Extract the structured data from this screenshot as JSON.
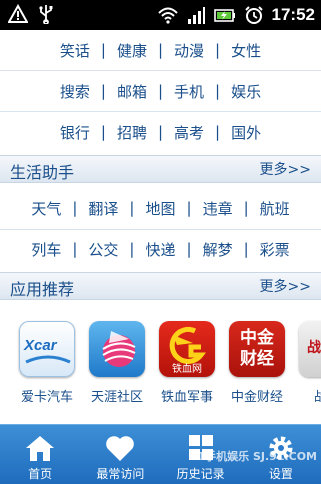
{
  "status_bar": {
    "time": "17:52",
    "icons": [
      "warning-icon",
      "usb-icon",
      "wifi-icon",
      "signal-icon",
      "battery-charging-icon",
      "alarm-icon"
    ]
  },
  "link_rows": [
    [
      "笑话",
      "健康",
      "动漫",
      "女性"
    ],
    [
      "搜索",
      "邮箱",
      "手机",
      "娱乐"
    ],
    [
      "银行",
      "招聘",
      "高考",
      "国外"
    ]
  ],
  "life_helper": {
    "title": "生活助手",
    "more": "更多>>",
    "rows": [
      [
        "天气",
        "翻译",
        "地图",
        "违章",
        "航班"
      ],
      [
        "列车",
        "公交",
        "快递",
        "解梦",
        "彩票"
      ]
    ]
  },
  "app_recommend": {
    "title": "应用推荐",
    "more": "更多>>",
    "apps": [
      {
        "label": "爱卡汽车",
        "icon_text": "Xcar",
        "icon_name": "xcar-app-icon"
      },
      {
        "label": "天涯社区",
        "icon_text": "",
        "icon_name": "tianya-app-icon"
      },
      {
        "label": "铁血军事",
        "icon_text": "铁血网",
        "icon_name": "tiexue-app-icon"
      },
      {
        "label": "中金财经",
        "icon_text": "中金财经",
        "icon_name": "zhongjin-app-icon"
      },
      {
        "label": "战略",
        "icon_text": "战略",
        "icon_name": "zhanlue-app-icon"
      }
    ]
  },
  "bottom_nav": [
    {
      "label": "首页",
      "icon": "home-icon"
    },
    {
      "label": "最常访问",
      "icon": "heart-icon"
    },
    {
      "label": "历史记录",
      "icon": "history-icon"
    },
    {
      "label": "设置",
      "icon": "gear-icon"
    }
  ],
  "watermark": "91手机娱乐 SJ.91.COM",
  "colors": {
    "link": "#1a4f8b",
    "nav_bar": "#2a7bcb",
    "status_bar": "#000000"
  }
}
